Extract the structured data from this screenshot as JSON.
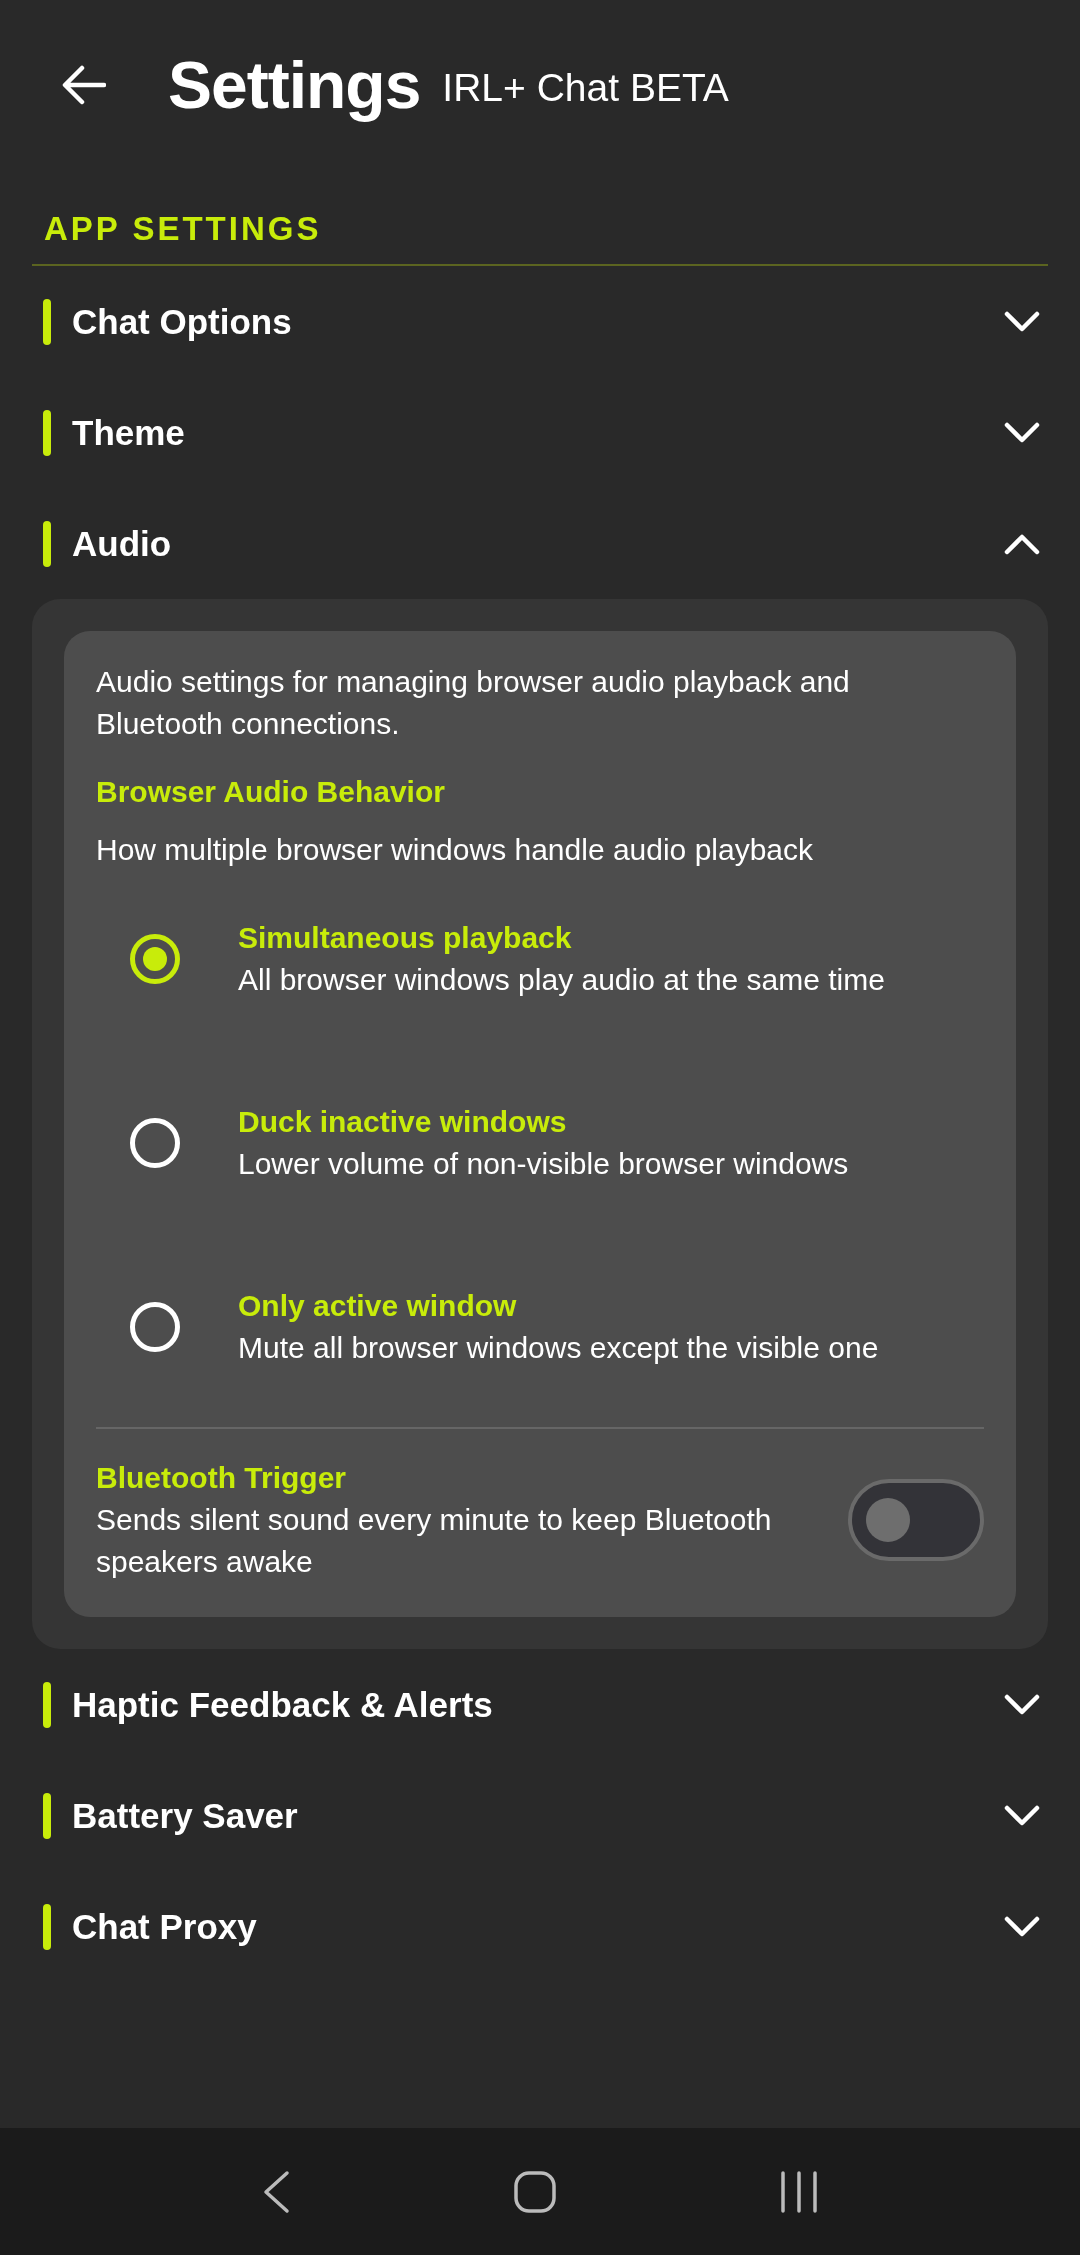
{
  "header": {
    "title": "Settings",
    "subtitle": "IRL+ Chat BETA"
  },
  "section": {
    "title": "APP SETTINGS"
  },
  "groups": [
    {
      "label": "Chat Options",
      "expanded": false
    },
    {
      "label": "Theme",
      "expanded": false
    },
    {
      "label": "Audio",
      "expanded": true,
      "panel": {
        "description": "Audio settings for managing browser audio playback and Bluetooth connections.",
        "behavior_title": "Browser Audio Behavior",
        "behavior_hint": "How multiple browser windows handle audio playback",
        "options": [
          {
            "title": "Simultaneous playback",
            "detail": "All browser windows play audio at the same time",
            "selected": true
          },
          {
            "title": "Duck inactive windows",
            "detail": "Lower volume of non-visible browser windows",
            "selected": false
          },
          {
            "title": "Only active window",
            "detail": "Mute all browser windows except the visible one",
            "selected": false
          }
        ],
        "toggle": {
          "title": "Bluetooth Trigger",
          "detail": "Sends silent sound every minute to keep Bluetooth speakers awake",
          "on": false
        }
      }
    },
    {
      "label": "Haptic Feedback & Alerts",
      "expanded": false
    },
    {
      "label": "Battery Saver",
      "expanded": false
    },
    {
      "label": "Chat Proxy",
      "expanded": false
    }
  ]
}
